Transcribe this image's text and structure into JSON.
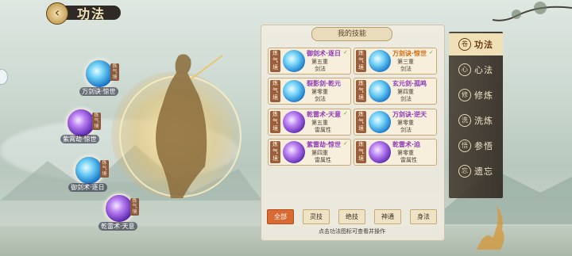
{
  "header": {
    "title": "功法",
    "back_icon": "back-arrow-icon"
  },
  "left_nodes": [
    {
      "label": "万剑诀·惊世",
      "tag": "炼气境",
      "color": "blue"
    },
    {
      "label": "紫霄劫·惊世",
      "tag": "炼气境",
      "color": "purple"
    },
    {
      "label": "御剑术·逐日",
      "tag": "炼气境",
      "color": "blue"
    },
    {
      "label": "乾雷术·天意",
      "tag": "炼气境",
      "color": "purple"
    }
  ],
  "panel": {
    "header": "我的技能",
    "cards": [
      {
        "tag": "炼气境",
        "name": "御剑术·逐日",
        "tier": "第五重",
        "prop": "剑法",
        "color": "blue",
        "name_color": "purple",
        "checked": true
      },
      {
        "tag": "炼气境",
        "name": "万剑诀·惊世",
        "tier": "第三重",
        "prop": "剑法",
        "color": "blue",
        "name_color": "orange",
        "checked": true
      },
      {
        "tag": "炼气境",
        "name": "裂影剑·乾元",
        "tier": "第零重",
        "prop": "剑法",
        "color": "blue",
        "name_color": "purple",
        "checked": false
      },
      {
        "tag": "炼气境",
        "name": "玄元剑·孤鸣",
        "tier": "第四重",
        "prop": "剑法",
        "color": "blue",
        "name_color": "purple",
        "checked": false
      },
      {
        "tag": "炼气境",
        "name": "乾雷术·天意",
        "tier": "第五重",
        "prop": "雷属性",
        "color": "purple",
        "name_color": "purple",
        "checked": true
      },
      {
        "tag": "炼气境",
        "name": "万剑诀·逆天",
        "tier": "第零重",
        "prop": "剑法",
        "color": "blue",
        "name_color": "purple",
        "checked": false
      },
      {
        "tag": "炼气境",
        "name": "紫雷劫·惊世",
        "tier": "第四重",
        "prop": "雷属性",
        "color": "purple",
        "name_color": "purple",
        "checked": true
      },
      {
        "tag": "炼气境",
        "name": "乾雷术·迫",
        "tier": "第零重",
        "prop": "雷属性",
        "color": "purple",
        "name_color": "purple",
        "checked": false
      }
    ],
    "filters": [
      "全部",
      "灵技",
      "绝技",
      "神通",
      "身法"
    ],
    "active_filter": "全部",
    "hint": "点击功法图标可查看并操作"
  },
  "menu": [
    {
      "label": "功法",
      "icon": "scroll-icon",
      "active": true
    },
    {
      "label": "心法",
      "icon": "heart-method-icon",
      "active": false
    },
    {
      "label": "修炼",
      "icon": "meditation-icon",
      "active": false
    },
    {
      "label": "洗炼",
      "icon": "refine-icon",
      "active": false
    },
    {
      "label": "参悟",
      "icon": "insight-icon",
      "active": false
    },
    {
      "label": "遗忘",
      "icon": "forget-icon",
      "active": false
    }
  ]
}
